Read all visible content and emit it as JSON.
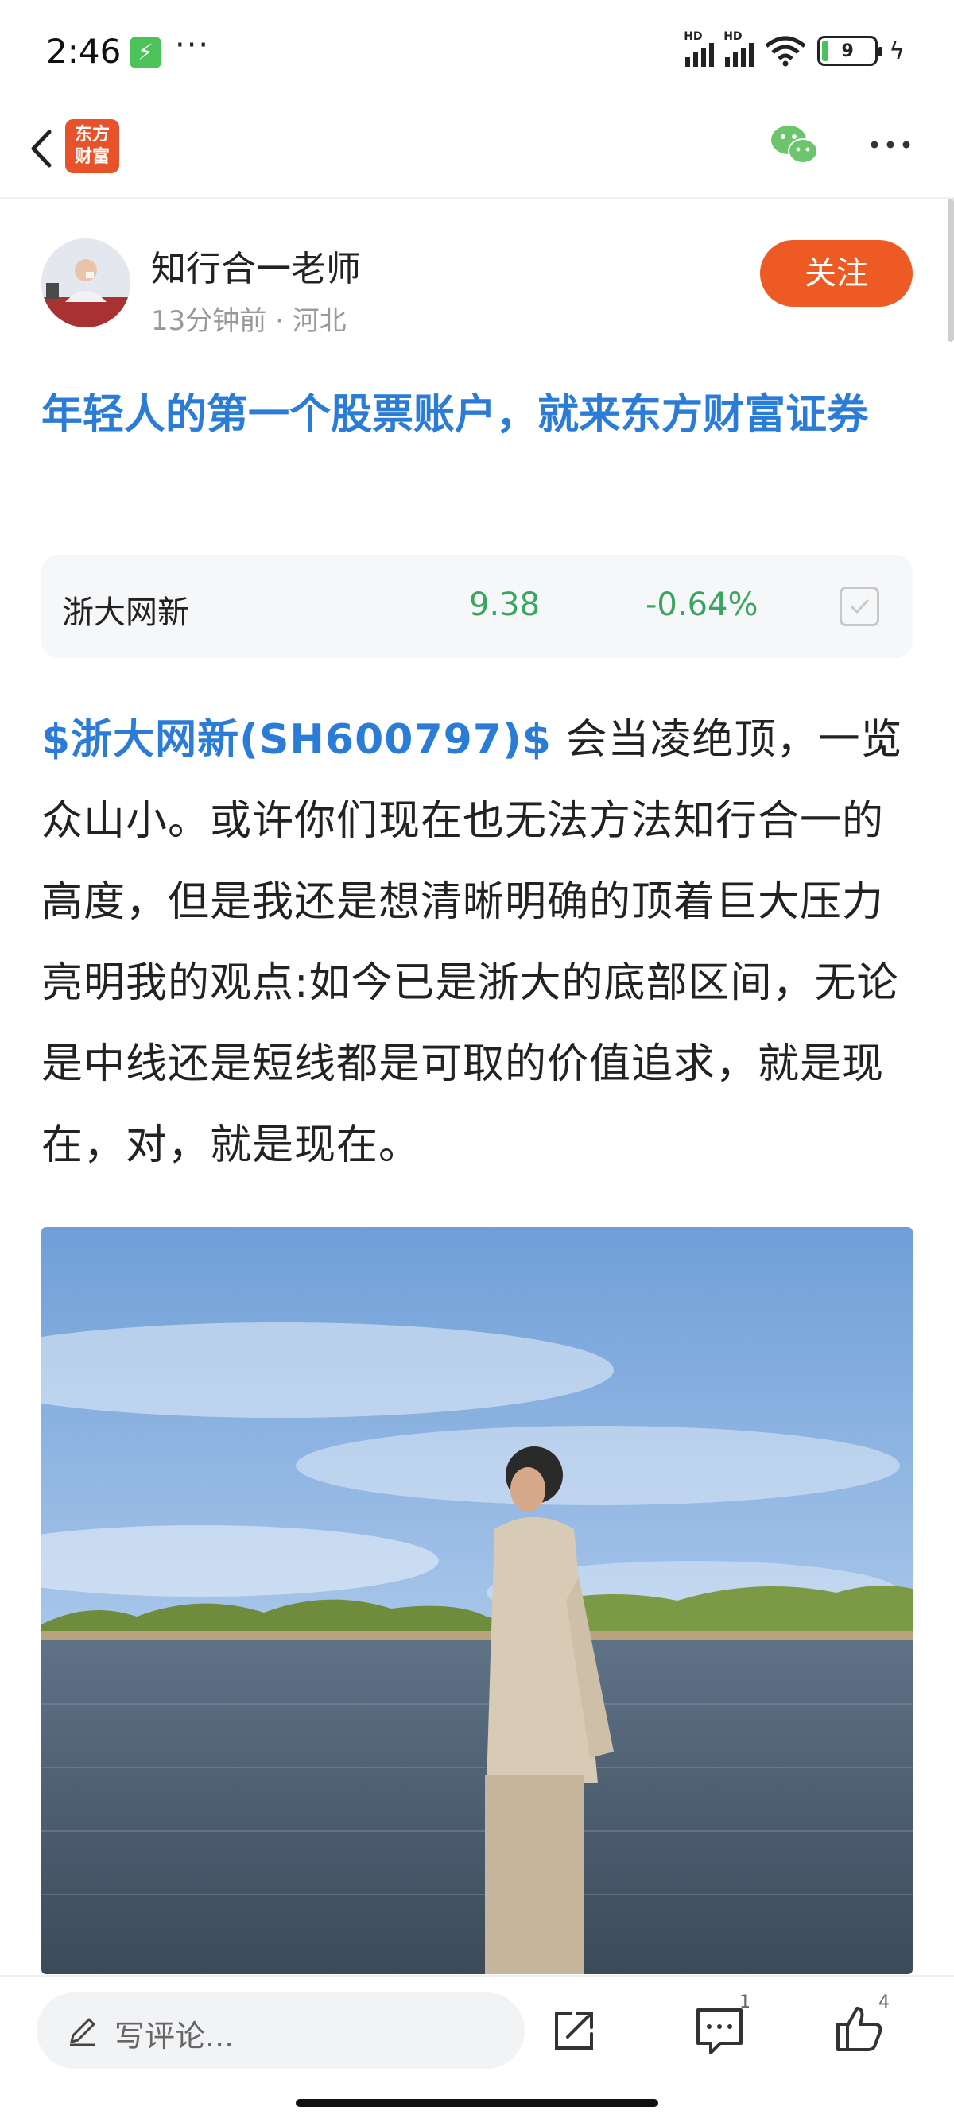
{
  "status_bar": {
    "time": "2:46",
    "battery": "9",
    "signal_label": "HD"
  },
  "header": {
    "logo_text_line1": "东方",
    "logo_text_line2": "财富"
  },
  "author": {
    "name": "知行合一老师",
    "meta": "13分钟前 · 河北",
    "follow_label": "关注"
  },
  "post": {
    "title": "年轻人的第一个股票账户，就来东方财富证券",
    "stock_link": "$浙大网新(SH600797)$",
    "body": " 会当凌绝顶，一览众山小。或许你们现在也无法方法知行合一的高度，但是我还是想清晰明确的顶着巨大压力亮明我的观点:如今已是浙大的底部区间，无论是中线还是短线都是可取的价值追求，就是现在，对，就是现在。"
  },
  "stock_card": {
    "name": "浙大网新",
    "price": "9.38",
    "change": "-0.64%"
  },
  "bottom_bar": {
    "comment_placeholder": "写评论...",
    "comment_count": "1",
    "like_count": "4"
  },
  "colors": {
    "accent_blue": "#2b7cd6",
    "follow_orange": "#ee5a24",
    "stock_green": "#3aa55e"
  }
}
